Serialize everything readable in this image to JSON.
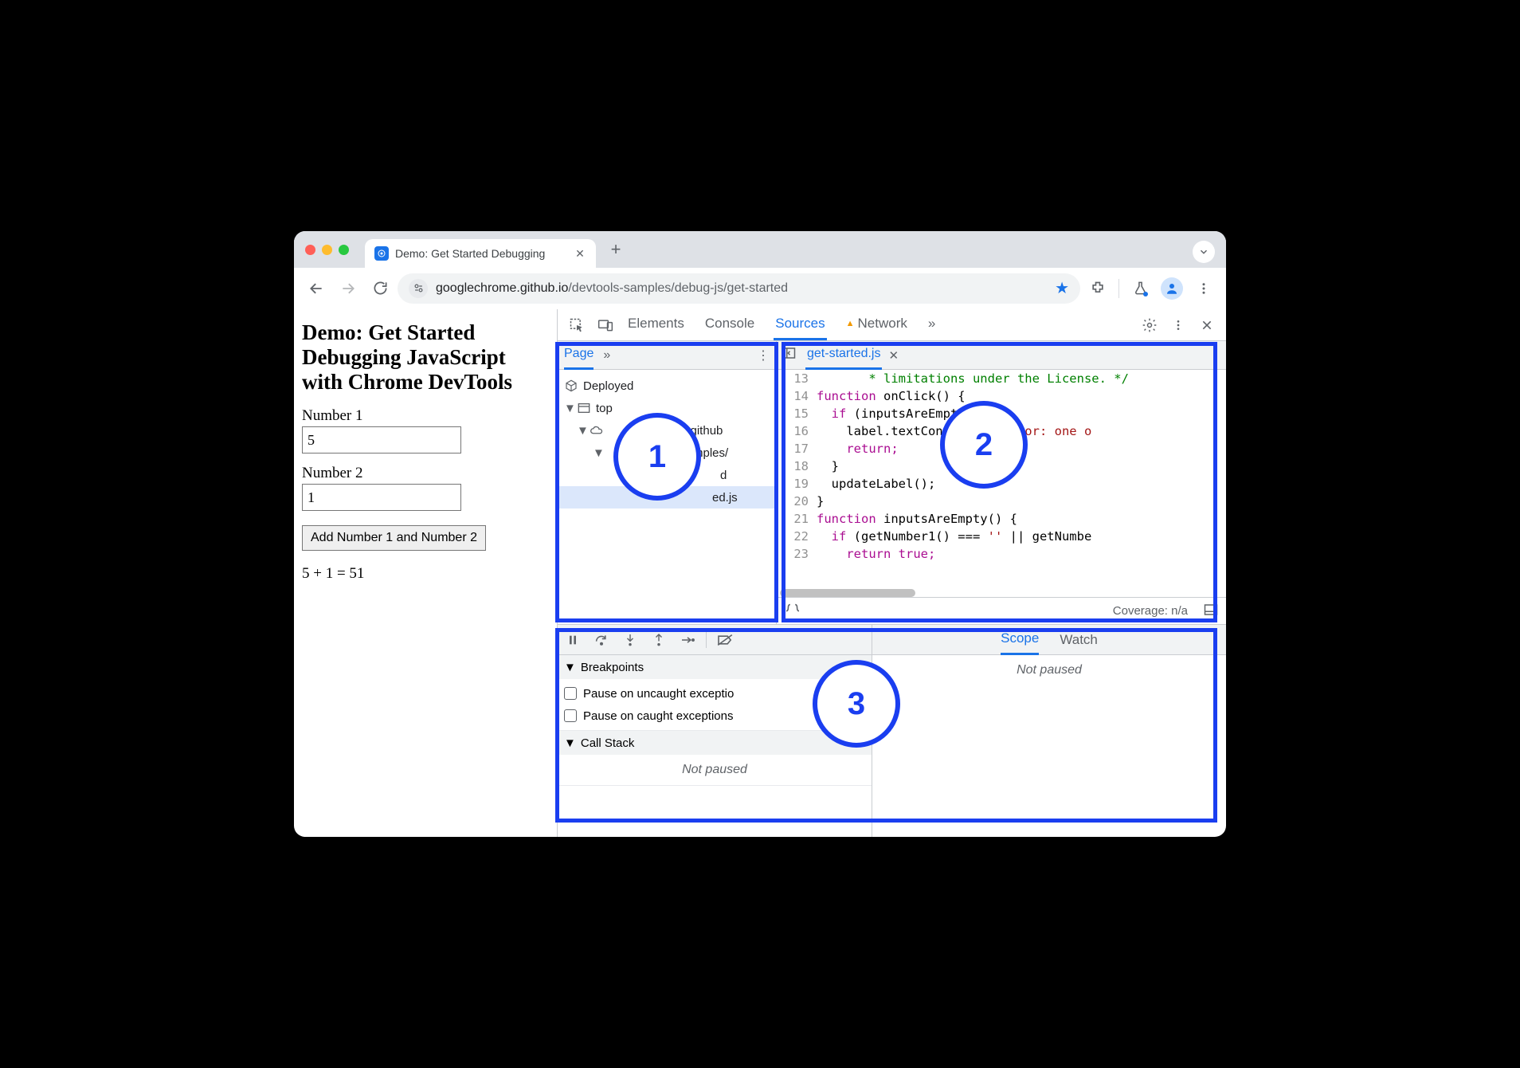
{
  "browser": {
    "tab_title": "Demo: Get Started Debugging",
    "url_host": "googlechrome.github.io",
    "url_path": "/devtools-samples/debug-js/get-started"
  },
  "page": {
    "heading": "Demo: Get Started Debugging JavaScript with Chrome DevTools",
    "label1": "Number 1",
    "value1": "5",
    "label2": "Number 2",
    "value2": "1",
    "button": "Add Number 1 and Number 2",
    "result": "5 + 1 = 51"
  },
  "devtools": {
    "top_tabs": {
      "elements": "Elements",
      "console": "Console",
      "sources": "Sources",
      "network": "Network"
    },
    "navigator": {
      "tab": "Page",
      "deployed": "Deployed",
      "top": "top",
      "origin": "e.github",
      "folder": "mples/",
      "folder2": "d",
      "file": "ed.js"
    },
    "editor": {
      "filename": "get-started.js",
      "lines": {
        "13": "       * limitations under the License. */",
        "14a": "function",
        "14b": " onClick() {",
        "15a": "  if",
        "15b": " (inputsAreEmpty()) {",
        "16a": "    label.textContent = ",
        "16b": "'Error: one o",
        "17": "    return;",
        "18": "  }",
        "19": "  updateLabel();",
        "20": "}",
        "21a": "function",
        "21b": " inputsAreEmpty() {",
        "22a": "  if",
        "22b": " (getNumber1() === ",
        "22c": "''",
        "22d": " || getNumbe",
        "23": "    return true;"
      },
      "coverage": "Coverage: n/a"
    },
    "debugger": {
      "breakpoints_hdr": "Breakpoints",
      "pause_uncaught": "Pause on uncaught exceptio",
      "pause_caught": "Pause on caught exceptions",
      "callstack_hdr": "Call Stack",
      "not_paused": "Not paused",
      "scope": "Scope",
      "watch": "Watch",
      "right_not_paused": "Not paused"
    }
  },
  "annotations": {
    "n1": "1",
    "n2": "2",
    "n3": "3"
  }
}
